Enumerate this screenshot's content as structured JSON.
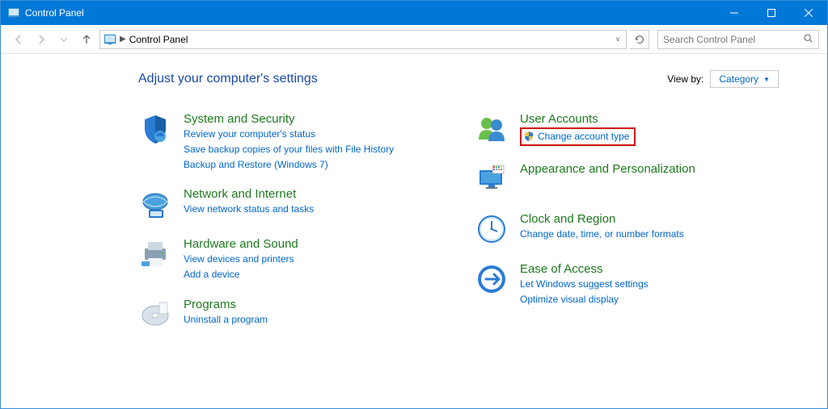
{
  "window": {
    "title": "Control Panel"
  },
  "address": {
    "location": "Control Panel"
  },
  "search": {
    "placeholder": "Search Control Panel"
  },
  "header": {
    "title": "Adjust your computer's settings"
  },
  "viewby": {
    "label": "View by:",
    "value": "Category"
  },
  "cats": {
    "system": {
      "title": "System and Security",
      "l1": "Review your computer's status",
      "l2": "Save backup copies of your files with File History",
      "l3": "Backup and Restore (Windows 7)"
    },
    "network": {
      "title": "Network and Internet",
      "l1": "View network status and tasks"
    },
    "hardware": {
      "title": "Hardware and Sound",
      "l1": "View devices and printers",
      "l2": "Add a device"
    },
    "programs": {
      "title": "Programs",
      "l1": "Uninstall a program"
    },
    "users": {
      "title": "User Accounts",
      "l1": "Change account type"
    },
    "appearance": {
      "title": "Appearance and Personalization"
    },
    "clock": {
      "title": "Clock and Region",
      "l1": "Change date, time, or number formats"
    },
    "ease": {
      "title": "Ease of Access",
      "l1": "Let Windows suggest settings",
      "l2": "Optimize visual display"
    }
  }
}
